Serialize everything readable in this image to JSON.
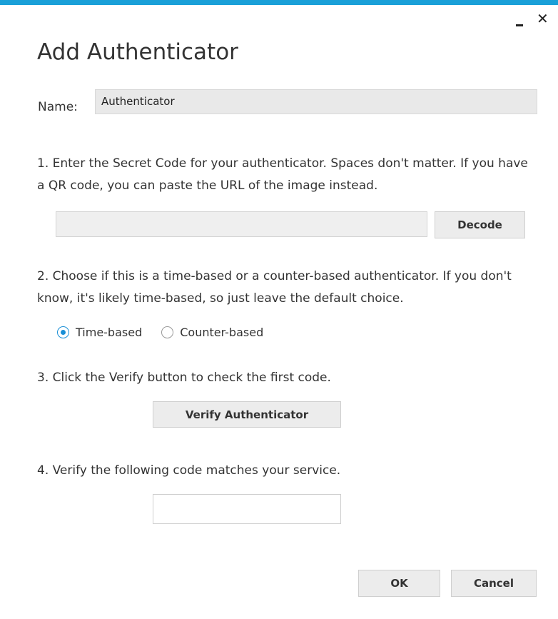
{
  "window": {
    "title": "Add Authenticator",
    "accent_color": "#1aa0d8",
    "minimize_icon": "minimize-icon",
    "close_icon": "close-icon",
    "close_glyph": "✕"
  },
  "name_field": {
    "label": "Name:",
    "value": "Authenticator"
  },
  "step1": {
    "text": "1. Enter the Secret Code for your authenticator. Spaces don't matter. If you have a QR code, you can paste the URL of the image instead.",
    "secret_value": "",
    "decode_label": "Decode"
  },
  "step2": {
    "text": "2. Choose if this is a time-based or a counter-based authenticator. If you don't know, it's likely time-based, so just leave the default choice.",
    "options": [
      {
        "label": "Time-based",
        "checked": true
      },
      {
        "label": "Counter-based",
        "checked": false
      }
    ]
  },
  "step3": {
    "text": "3. Click the Verify button to check the first code.",
    "verify_label": "Verify Authenticator"
  },
  "step4": {
    "text": "4. Verify the following code matches your service.",
    "code_value": ""
  },
  "footer": {
    "ok_label": "OK",
    "cancel_label": "Cancel"
  }
}
